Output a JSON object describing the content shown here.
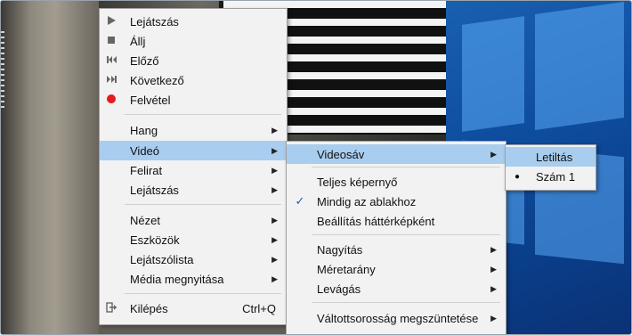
{
  "main_menu": {
    "items": [
      {
        "label": "Lejátszás",
        "icon": "play-icon"
      },
      {
        "label": "Állj",
        "icon": "stop-icon"
      },
      {
        "label": "Előző",
        "icon": "previous-icon"
      },
      {
        "label": "Következő",
        "icon": "next-icon"
      },
      {
        "label": "Felvétel",
        "icon": "record-icon"
      },
      {
        "label": "Hang",
        "submenu": true
      },
      {
        "label": "Videó",
        "submenu": true,
        "highlighted": true
      },
      {
        "label": "Felirat",
        "submenu": true
      },
      {
        "label": "Lejátszás",
        "submenu": true
      },
      {
        "label": "Nézet",
        "submenu": true
      },
      {
        "label": "Eszközök",
        "submenu": true
      },
      {
        "label": "Lejátszólista",
        "submenu": true
      },
      {
        "label": "Média megnyitása",
        "submenu": true
      },
      {
        "label": "Kilépés",
        "icon": "exit-icon",
        "shortcut": "Ctrl+Q"
      }
    ]
  },
  "video_menu": {
    "items": [
      {
        "label": "Videosáv",
        "submenu": true,
        "highlighted": true
      },
      {
        "label": "Teljes képernyő"
      },
      {
        "label": "Mindig az ablakhoz",
        "checked": true
      },
      {
        "label": "Beállítás háttérképként"
      },
      {
        "label": "Nagyítás",
        "submenu": true
      },
      {
        "label": "Méretarány",
        "submenu": true
      },
      {
        "label": "Levágás",
        "submenu": true
      },
      {
        "label": "Váltottsorosság megszüntetése",
        "submenu": true
      }
    ]
  },
  "track_menu": {
    "items": [
      {
        "label": "Letiltás",
        "highlighted": true
      },
      {
        "label": "Szám 1",
        "selected": true
      }
    ]
  },
  "colors": {
    "highlight": "#a9cdef",
    "record": "#e31b1b",
    "menu_bg": "#f2f2f2"
  }
}
